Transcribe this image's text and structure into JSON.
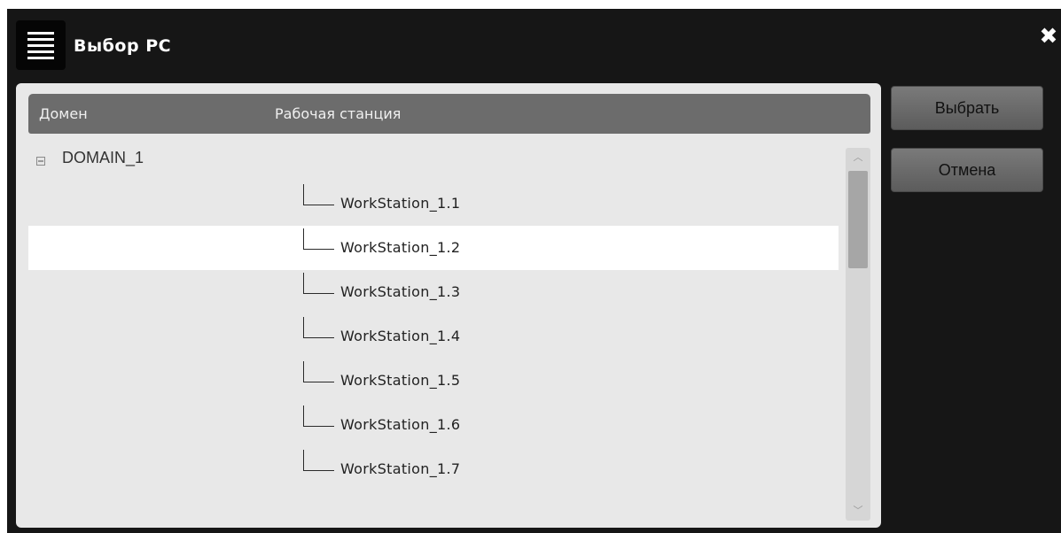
{
  "window": {
    "title": "Выбор РС",
    "close_label": "✖"
  },
  "table": {
    "headers": {
      "domain": "Домен",
      "workstation": "Рабочая станция"
    },
    "domain": {
      "name": "DOMAIN_1",
      "expanded": true
    },
    "workstations": [
      {
        "name": "WorkStation_1.1",
        "selected": false
      },
      {
        "name": "WorkStation_1.2",
        "selected": true
      },
      {
        "name": "WorkStation_1.3",
        "selected": false
      },
      {
        "name": "WorkStation_1.4",
        "selected": false
      },
      {
        "name": "WorkStation_1.5",
        "selected": false
      },
      {
        "name": "WorkStation_1.6",
        "selected": false
      },
      {
        "name": "WorkStation_1.7",
        "selected": false
      }
    ]
  },
  "scrollbar": {
    "up_glyph": "︿",
    "down_glyph": "﹀"
  },
  "buttons": {
    "select_label": "Выбрать",
    "cancel_label": "Отмена"
  },
  "colors": {
    "window_bg": "#161616",
    "panel_bg": "#e8e8e8",
    "header_bg": "#6c6c6c",
    "selected_row_bg": "#ffffff",
    "button_bg": "#6a6a6a"
  }
}
